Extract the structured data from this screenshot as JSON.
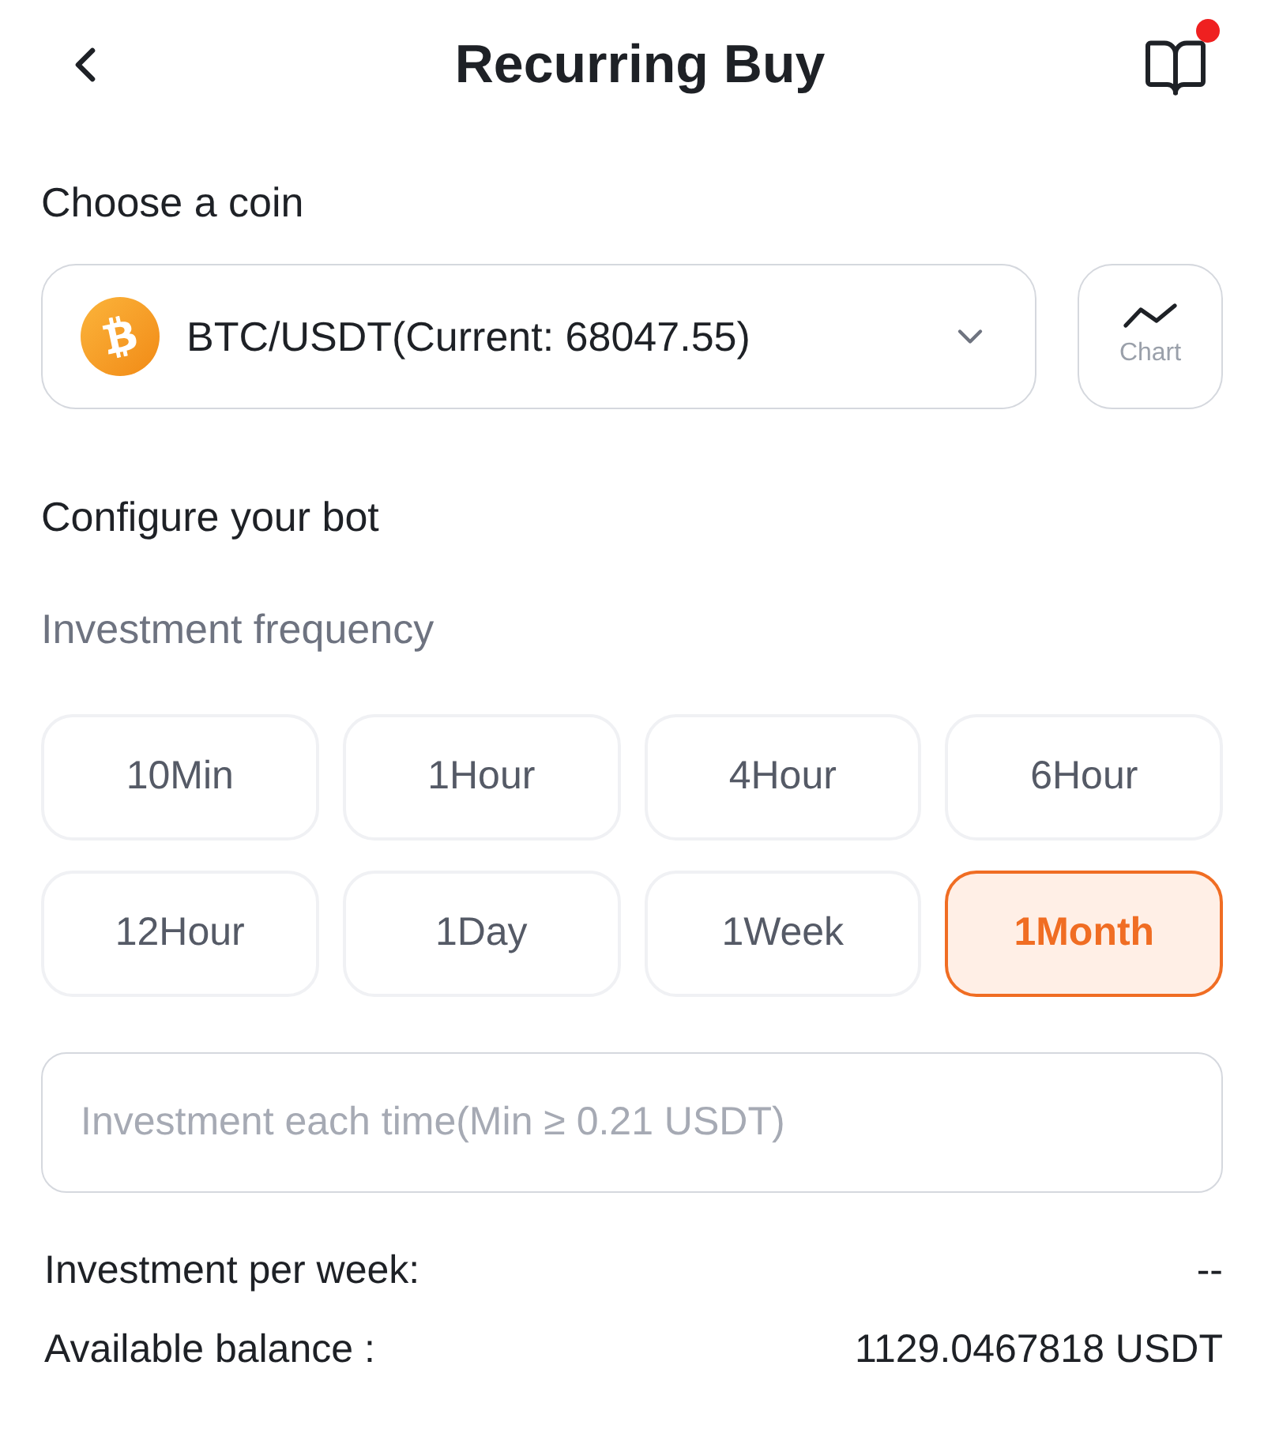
{
  "header": {
    "title": "Recurring Buy",
    "notification_dot": true
  },
  "coin_section": {
    "heading": "Choose a coin",
    "selector": {
      "value": "BTC/USDT(Current: 68047.55)"
    },
    "chart_button": {
      "label": "Chart"
    }
  },
  "config_section": {
    "heading": "Configure your bot",
    "frequency_label": "Investment frequency",
    "frequencies": [
      {
        "label": "10Min",
        "selected": false
      },
      {
        "label": "1Hour",
        "selected": false
      },
      {
        "label": "4Hour",
        "selected": false
      },
      {
        "label": "6Hour",
        "selected": false
      },
      {
        "label": "12Hour",
        "selected": false
      },
      {
        "label": "1Day",
        "selected": false
      },
      {
        "label": "1Week",
        "selected": false
      },
      {
        "label": "1Month",
        "selected": true
      }
    ]
  },
  "investment_input": {
    "placeholder": "Investment each time(Min ≥ 0.21 USDT)"
  },
  "summary": [
    {
      "label": "Investment per week:",
      "value": "--"
    },
    {
      "label": "Available balance :",
      "value": "1129.0467818 USDT"
    }
  ]
}
